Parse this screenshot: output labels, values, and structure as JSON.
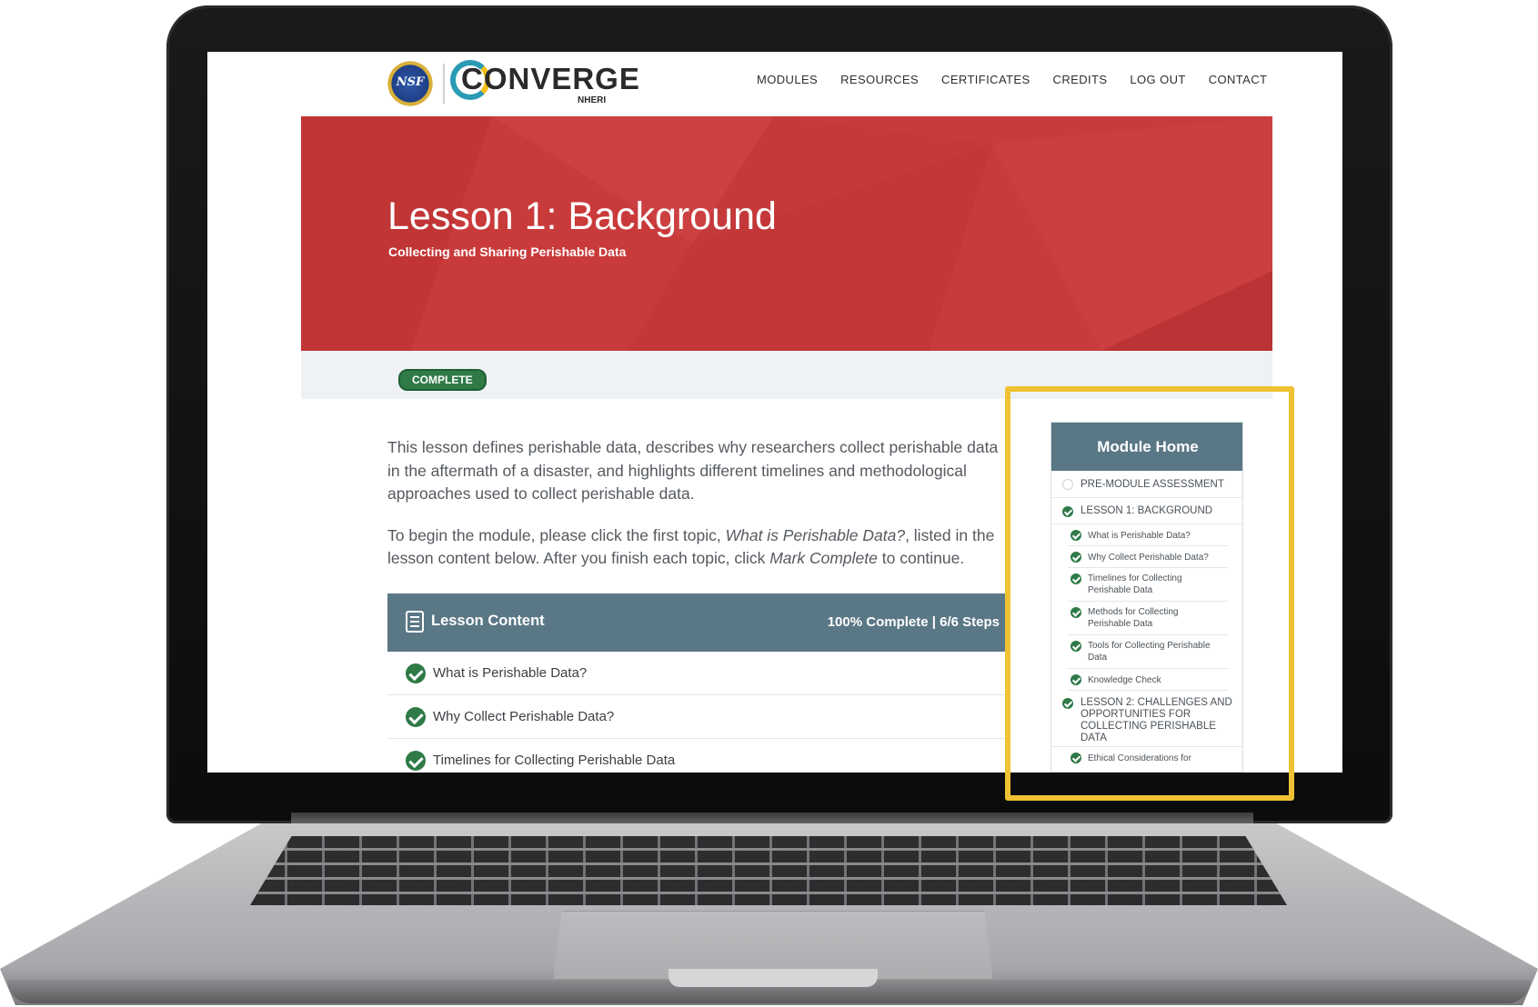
{
  "brand": {
    "seal_text": "NSF",
    "name": "CONVERGE",
    "sub": "NHERI"
  },
  "nav": {
    "items": [
      "MODULES",
      "RESOURCES",
      "CERTIFICATES",
      "CREDITS",
      "LOG OUT",
      "CONTACT"
    ]
  },
  "hero": {
    "title": "Lesson 1: Background",
    "subtitle": "Collecting and Sharing Perishable Data"
  },
  "status": {
    "badge": "COMPLETE"
  },
  "intro": {
    "p1": "This lesson defines perishable data, describes why researchers collect perishable data in the aftermath of a disaster, and highlights different timelines and methodological approaches used to collect perishable data.",
    "p2_a": "To begin the module, please click the first topic, ",
    "p2_topic": "What is Perishable Data?",
    "p2_b": ", listed in the lesson content below. After you finish each topic, click ",
    "p2_action": "Mark Complete",
    "p2_c": " to continue."
  },
  "lesson_content": {
    "title": "Lesson Content",
    "progress": "100% Complete | 6/6 Steps",
    "progress_fraction": 1.0,
    "rows": [
      "What is Perishable Data?",
      "Why Collect Perishable Data?",
      "Timelines for Collecting Perishable Data"
    ]
  },
  "sidebar": {
    "title": "Module Home",
    "items": [
      {
        "label": "PRE-MODULE ASSESSMENT",
        "done": false
      },
      {
        "label": "LESSON 1: BACKGROUND",
        "done": true
      },
      {
        "label": "What is Perishable Data?",
        "done": true
      },
      {
        "label": "Why Collect Perishable Data?",
        "done": true
      },
      {
        "label": "Timelines for Collecting Perishable Data",
        "done": true
      },
      {
        "label": "Methods for Collecting Perishable Data",
        "done": true
      },
      {
        "label": "Tools for Collecting Perishable Data",
        "done": true
      },
      {
        "label": "Knowledge Check",
        "done": true
      },
      {
        "label": "LESSON 2: CHALLENGES AND OPPORTUNITIES FOR COLLECTING PERISHABLE DATA",
        "done": true
      },
      {
        "label": "Ethical Considerations for",
        "done": true
      }
    ]
  },
  "colors": {
    "hero_red": "#c93a3b",
    "header_slate": "#5a7786",
    "check_green": "#2f7a47",
    "highlight_yellow": "#f0c132"
  },
  "icons": [
    "nsf-seal-icon",
    "converge-logo-icon",
    "lesson-content-document-icon",
    "check-circle-icon",
    "empty-circle-icon"
  ]
}
